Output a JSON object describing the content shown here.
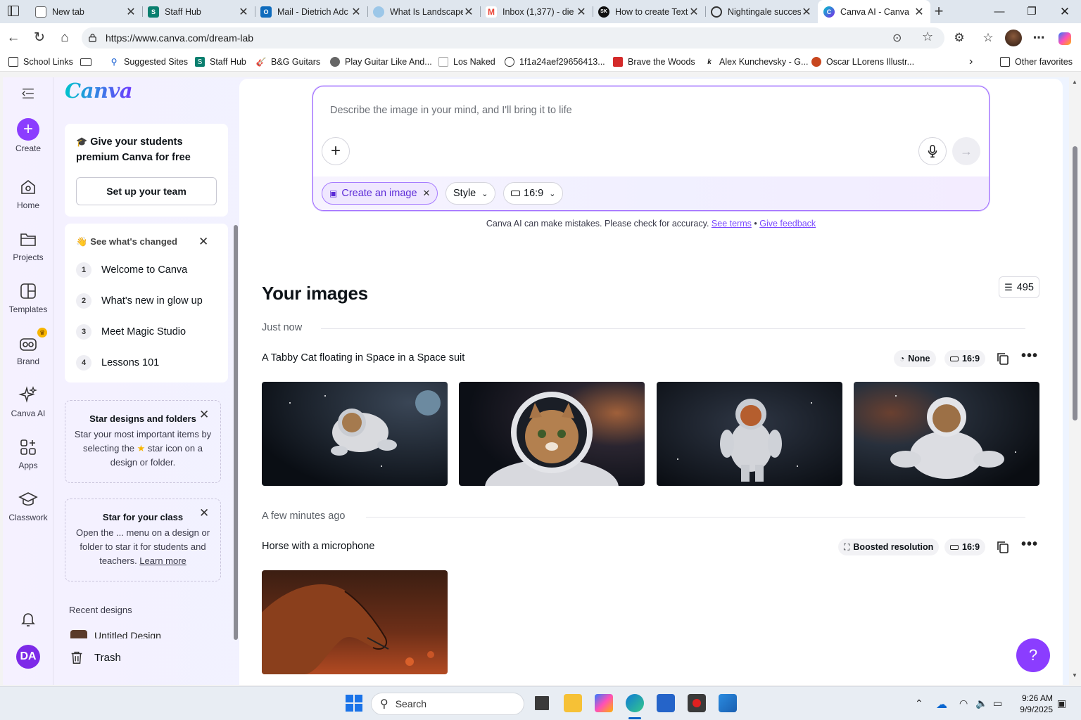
{
  "browser": {
    "tabs": [
      {
        "title": "New tab",
        "icon": "new-tab-icon",
        "color": "#cfd6de"
      },
      {
        "title": "Staff Hub",
        "icon": "staff-hub-icon",
        "color": "#0a7f6f"
      },
      {
        "title": "Mail - Dietrich Adc",
        "icon": "outlook-icon",
        "color": "#0f6cbd"
      },
      {
        "title": "What Is Landscape",
        "icon": "globe-icon",
        "color": "#6db3e3"
      },
      {
        "title": "Inbox (1,377) - die",
        "icon": "gmail-icon",
        "color": "#ea4335"
      },
      {
        "title": "How to create Text",
        "icon": "sk-icon",
        "color": "#111111"
      },
      {
        "title": "Nightingale succes",
        "icon": "openai-icon",
        "color": "#333333"
      },
      {
        "title": "Canva AI - Canva",
        "icon": "canva-icon",
        "color": "#00c4cc",
        "active": true
      }
    ],
    "url": "https://www.canva.com/dream-lab",
    "bookmarks": [
      {
        "label": "School Links",
        "icon": "folder-icon"
      },
      {
        "label": "",
        "icon": "reader-icon"
      },
      {
        "label": "Suggested Sites",
        "icon": "search-icon"
      },
      {
        "label": "Staff Hub",
        "icon": "staff-hub-icon"
      },
      {
        "label": "B&G Guitars",
        "icon": "guitar-icon"
      },
      {
        "label": "Play Guitar Like And...",
        "icon": "guitar-pick-icon"
      },
      {
        "label": "Los Naked",
        "icon": "page-icon"
      },
      {
        "label": "1f1a24aef29656413...",
        "icon": "globe-icon"
      },
      {
        "label": "Brave the Woods",
        "icon": "shield-icon"
      },
      {
        "label": "Alex Kunchevsky - G...",
        "icon": "k-icon"
      },
      {
        "label": "Oscar LLorens Illustr...",
        "icon": "fox-icon"
      }
    ],
    "other_favorites": "Other favorites"
  },
  "rail": {
    "create": "Create",
    "items": [
      "Home",
      "Projects",
      "Templates",
      "Brand",
      "Canva AI",
      "Apps",
      "Classwork"
    ],
    "avatar_initials": "DA"
  },
  "panel": {
    "logo": "Canva",
    "promo": {
      "title": "Give your students premium Canva for free",
      "button": "Set up your team"
    },
    "changed": {
      "title": "See what's changed",
      "steps": [
        {
          "n": "1",
          "label": "Welcome to Canva"
        },
        {
          "n": "2",
          "label": "What's new in glow up"
        },
        {
          "n": "3",
          "label": "Meet Magic Studio"
        },
        {
          "n": "4",
          "label": "Lessons 101"
        }
      ]
    },
    "star_designs": {
      "title": "Star designs and folders",
      "body_pre": "Star your most important items by selecting the ",
      "body_post": " star icon on a design or folder."
    },
    "star_class": {
      "title": "Star for your class",
      "body": "Open the ... menu on a design or folder to star it for students and teachers. ",
      "link": "Learn more"
    },
    "recent_title": "Recent designs",
    "recent_item": "Untitled Design",
    "trash": "Trash"
  },
  "prompt": {
    "placeholder": "Describe the image in your mind, and I'll bring it to life",
    "chip_create": "Create an image",
    "chip_style": "Style",
    "chip_ratio": "16:9"
  },
  "disclaimer": {
    "text": "Canva AI can make mistakes. Please check for accuracy.",
    "terms": "See terms",
    "sep": "•",
    "feedback": "Give feedback"
  },
  "images": {
    "heading": "Your images",
    "credits": "495",
    "groups": [
      {
        "time": "Just now",
        "title": "A Tabby Cat floating in Space in a Space suit",
        "style_tag": "None",
        "ratio_tag": "16:9",
        "count": 4
      },
      {
        "time": "A few minutes ago",
        "title": "Horse with a microphone",
        "style_tag": "Boosted resolution",
        "ratio_tag": "16:9",
        "count": 1
      }
    ]
  },
  "help": "?",
  "taskbar": {
    "search": "Search",
    "time": "9:26 AM",
    "date": "9/9/2025"
  }
}
